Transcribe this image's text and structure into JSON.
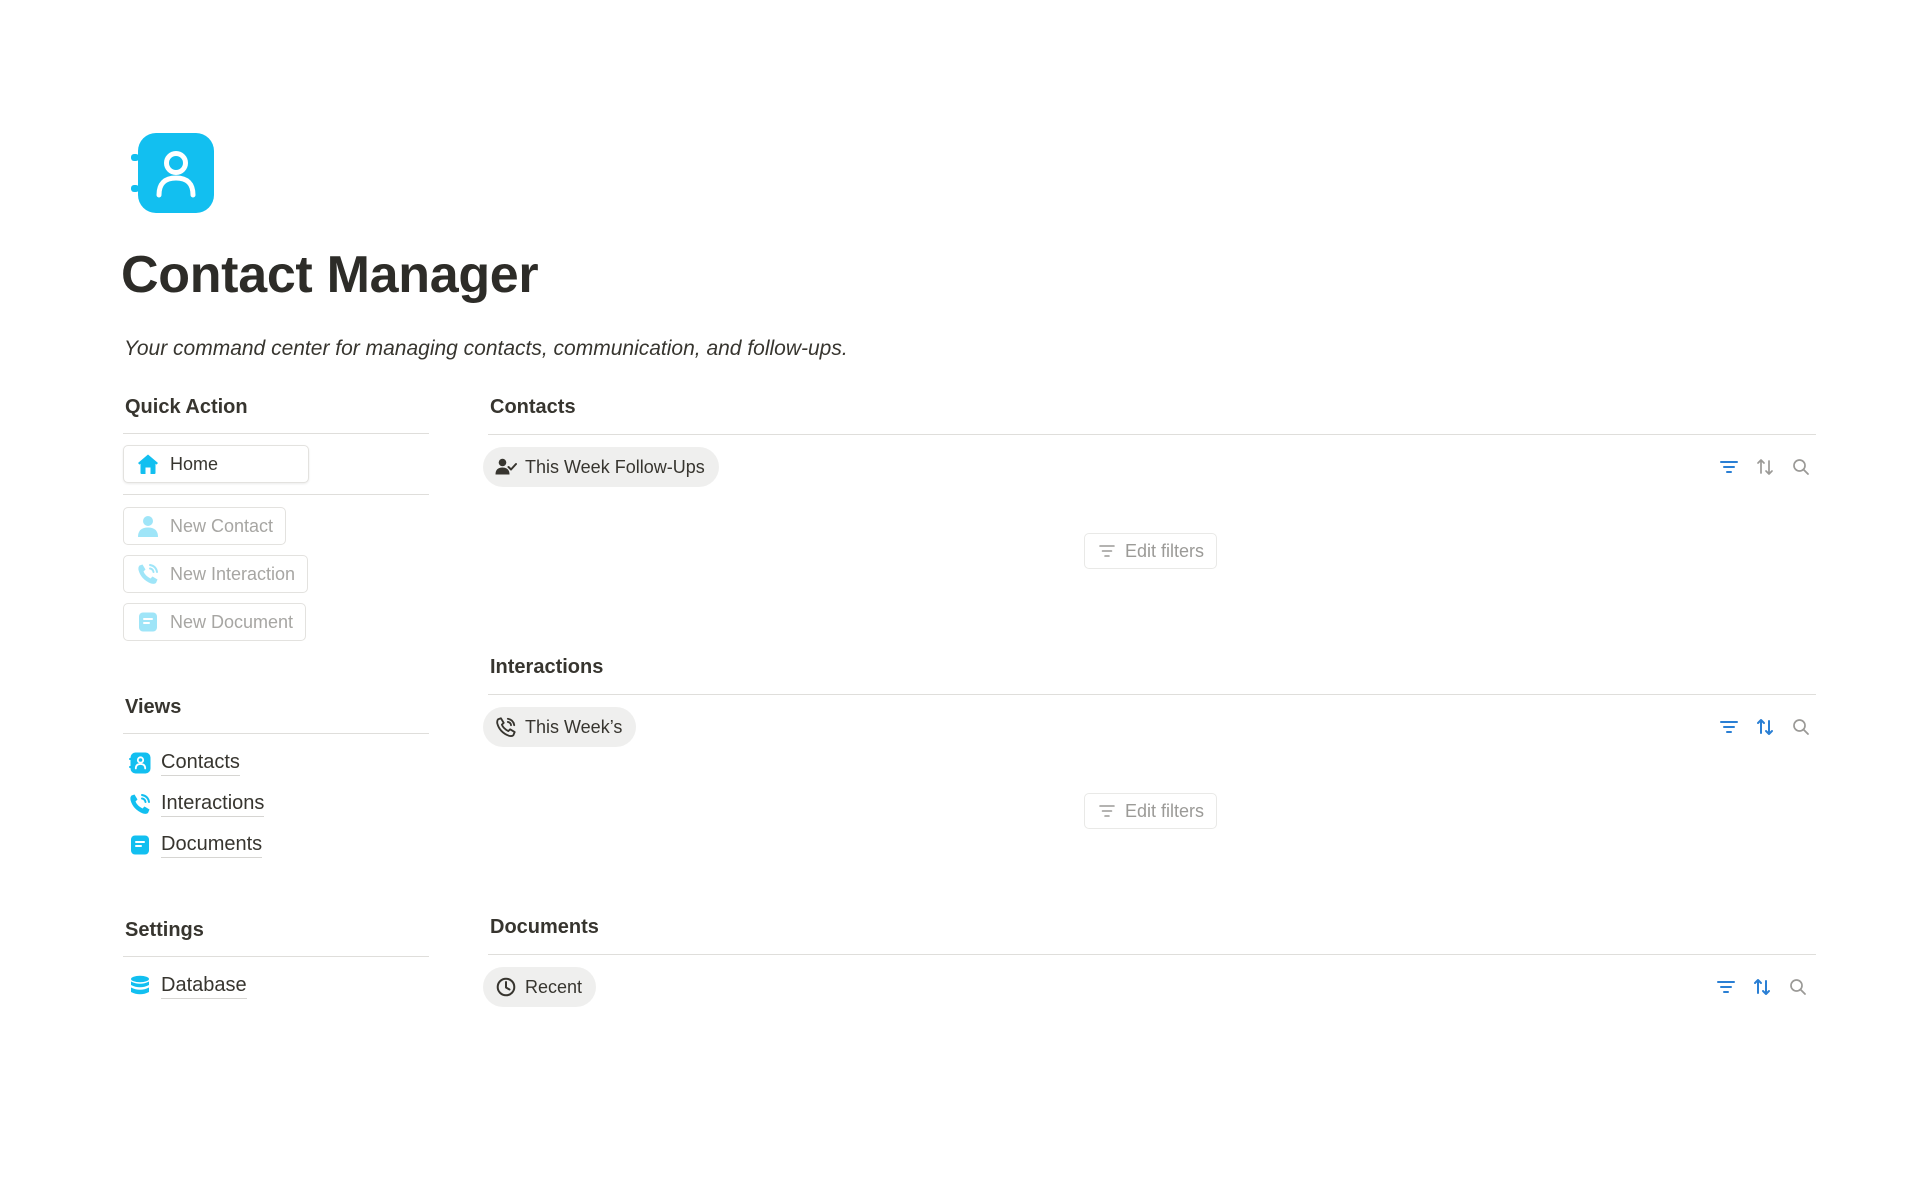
{
  "page": {
    "title": "Contact Manager",
    "description": "Your command center for managing contacts, communication, and follow-ups.",
    "icon": "contact-book-icon",
    "accent_color": "#12bff0"
  },
  "quick_action": {
    "heading": "Quick Action",
    "home_button": {
      "label": "Home",
      "icon": "home-icon"
    },
    "buttons": [
      {
        "label": "New Contact",
        "icon": "person-icon"
      },
      {
        "label": "New Interaction",
        "icon": "phone-icon"
      },
      {
        "label": "New Document",
        "icon": "document-icon"
      }
    ]
  },
  "views": {
    "heading": "Views",
    "items": [
      {
        "label": "Contacts",
        "icon": "contact-book-icon"
      },
      {
        "label": "Interactions",
        "icon": "phone-icon"
      },
      {
        "label": "Documents",
        "icon": "document-icon"
      }
    ]
  },
  "settings": {
    "heading": "Settings",
    "items": [
      {
        "label": "Database",
        "icon": "database-icon"
      }
    ]
  },
  "blocks": [
    {
      "heading": "Contacts",
      "view_tab": {
        "label": "This Week Follow-Ups",
        "icon": "person-check-icon"
      },
      "edit_filters_label": "Edit filters",
      "sort_active": false
    },
    {
      "heading": "Interactions",
      "view_tab": {
        "label": "This Week’s",
        "icon": "phone-icon"
      },
      "edit_filters_label": "Edit filters",
      "sort_active": true
    },
    {
      "heading": "Documents",
      "view_tab": {
        "label": "Recent",
        "icon": "clock-icon"
      },
      "sort_active": true
    }
  ],
  "colors": {
    "tool_blue": "#2a7fd4",
    "tool_gray": "#9b9a97",
    "muted_text": "#a7a6a3"
  }
}
